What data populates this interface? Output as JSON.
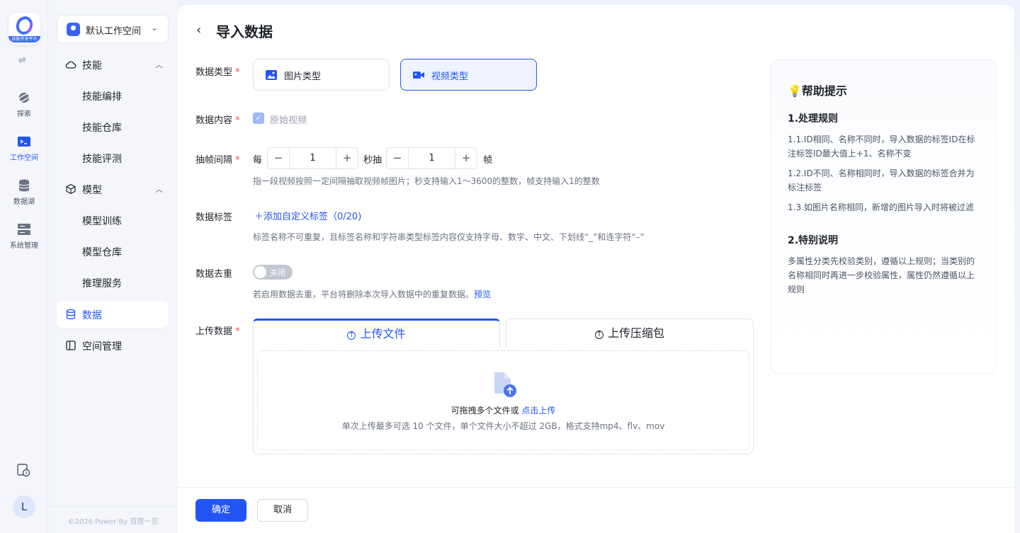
{
  "rail": {
    "logo_text": "技能开发平台",
    "items": [
      {
        "label": "探索"
      },
      {
        "label": "工作空间"
      },
      {
        "label": "数据湖"
      },
      {
        "label": "系统管理"
      }
    ],
    "avatar": "L"
  },
  "sidebar": {
    "workspace": "默认工作空间",
    "groups": [
      {
        "label": "技能",
        "children": [
          "技能编排",
          "技能仓库",
          "技能评测"
        ]
      },
      {
        "label": "模型",
        "children": [
          "模型训练",
          "模型仓库",
          "推理服务"
        ]
      }
    ],
    "data": "数据",
    "space": "空间管理",
    "copyright": "©2026 Power By 百度一见"
  },
  "page": {
    "title": "导入数据",
    "type_label": "数据类型",
    "type_image": "图片类型",
    "type_video": "视频类型",
    "content_label": "数据内容",
    "content_value": "原始视频",
    "interval_label": "抽帧间隔",
    "per": "每",
    "per_value": "1",
    "seconds": "秒抽",
    "frame_value": "1",
    "frames": "帧",
    "interval_hint": "指一段视频按照一定间隔抽取视频帧图片；秒支持输入1～3600的整数，帧支持输入1的整数",
    "tag_label": "数据标签",
    "tag_add": "＋添加自定义标签（0/20)",
    "tag_hint": "标签名称不可重复，且标签名称和字符串类型标签内容仅支持字母、数字、中文、下划线“_”和连字符“–”",
    "dedup_label": "数据去重",
    "dedup_toggle": "关闭",
    "dedup_hint": "若启用数据去重，平台将删除本次导入数据中的重复数据。",
    "dedup_preview": "预览",
    "upload_label": "上传数据",
    "tab_file": "上传文件",
    "tab_zip": "上传压缩包",
    "upload_main": "可拖拽多个文件或",
    "upload_link": "点击上传",
    "upload_sub": "单次上传最多可选 10 个文件，单个文件大小不超过 2GB，格式支持mp4、flv、mov",
    "ok": "确定",
    "cancel": "取消"
  },
  "help": {
    "title": "💡帮助提示",
    "h1": "1.处理规则",
    "p1": "1.1.ID相同、名称不同时，导入数据的标签ID在标注标签ID最大值上+1、名称不变",
    "p2": "1.2.ID不同、名称相同时，导入数据的标签合并为标注标签",
    "p3": "1.3.如图片名称相同，新增的图片导入时将被过滤",
    "h2": "2.特别说明",
    "p4": "多属性分类先校验类别，遵循以上规则；当类别的名称相同时再进一步校验属性，属性仍然遵循以上规则"
  },
  "colors": {
    "accent": "#2355f5",
    "required": "#f04a4a"
  }
}
